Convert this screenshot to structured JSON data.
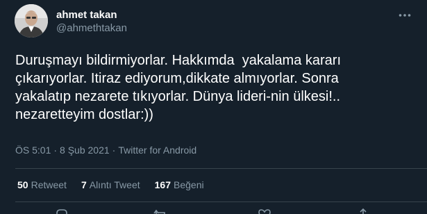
{
  "author": {
    "display_name": "ahmet takan",
    "handle": "@ahmethtakan",
    "avatar_icon": "user-avatar-photo"
  },
  "tweet": {
    "text": "Duruşmayı bildirmiyorlar. Hakkımda  yakalama kararı\nçıkarıyorlar. Itiraz ediyorum,dikkate almıyorlar. Sonra\nyakalatıp nezarete tıkıyorlar. Dünya lideri-nin ülkesi!..\nnezaretteyim dostlar:))"
  },
  "meta": {
    "time": "ÖS 5:01",
    "separator": "·",
    "date": "8 Şub 2021",
    "source": "Twitter for Android"
  },
  "stats": {
    "retweets_count": "50",
    "retweets_label": "Retweet",
    "quotes_count": "7",
    "quotes_label": "Alıntı Tweet",
    "likes_count": "167",
    "likes_label": "Beğeni"
  },
  "icons": {
    "more": "more-horizontal-icon",
    "reply": "reply-icon",
    "retweet": "retweet-icon",
    "like": "heart-icon",
    "share": "share-icon"
  },
  "colors": {
    "background": "#15202b",
    "text_primary": "#ffffff",
    "text_secondary": "#8899a6",
    "divider": "#38444d"
  }
}
